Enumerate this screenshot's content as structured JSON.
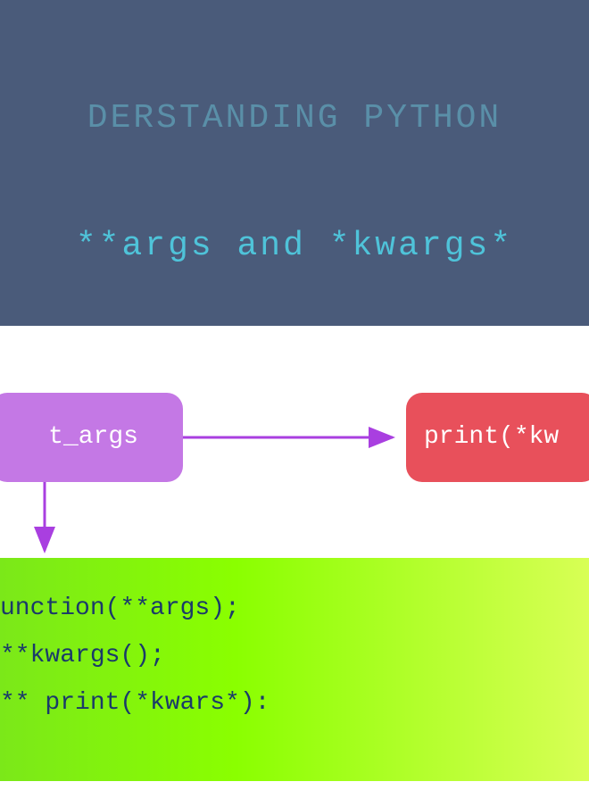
{
  "header": {
    "line1": "DERSTANDING PYTHON",
    "line2": "**args and *kwargs*"
  },
  "boxes": {
    "left_label": "t_args",
    "right_label": "print(*kw"
  },
  "code": {
    "line1": "unction(**args);",
    "line2": "**kwargs();",
    "line3": "** print(*kwars*):"
  },
  "colors": {
    "header_bg": "#4a5b7a",
    "header_fg1": "#5a8fa8",
    "header_fg2": "#4fc3d9",
    "box_left": "#c478e5",
    "box_right": "#e8505b",
    "arrow": "#a93fe0",
    "code_start": "#7be819",
    "code_end": "#d8ff55",
    "code_text": "#1a3a6a"
  }
}
